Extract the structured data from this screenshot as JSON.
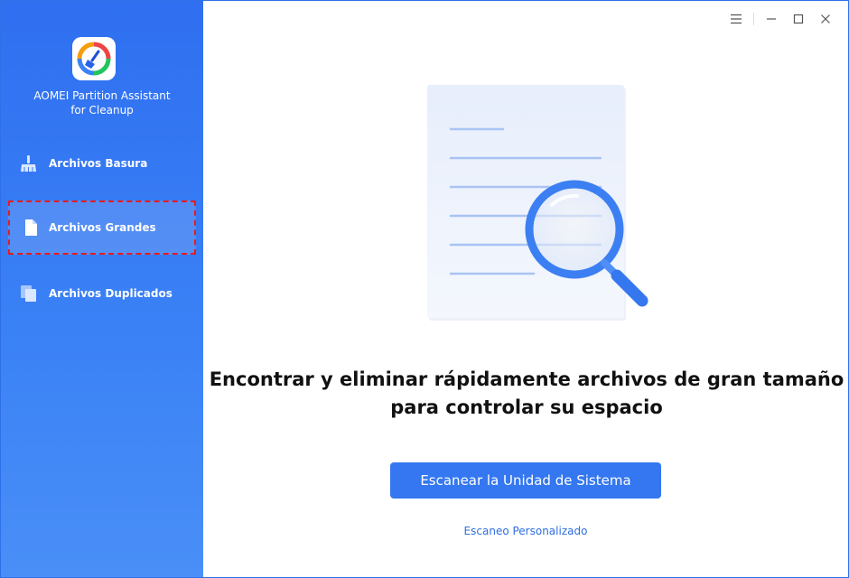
{
  "app": {
    "title_line1": "AOMEI Partition Assistant",
    "title_line2": "for Cleanup",
    "logo_icon": "broom-icon"
  },
  "sidebar": {
    "items": [
      {
        "label": "Archivos Basura",
        "icon": "broom-icon",
        "active": false
      },
      {
        "label": "Archivos Grandes",
        "icon": "file-icon",
        "active": true
      },
      {
        "label": "Archivos Duplicados",
        "icon": "copy-icon",
        "active": false
      }
    ]
  },
  "window_controls": [
    "menu-icon",
    "minimize-icon",
    "maximize-icon",
    "close-icon"
  ],
  "main": {
    "headline_line1": "Encontrar y eliminar rápidamente archivos de gran tamaño",
    "headline_line2": "para controlar su espacio",
    "primary_button": "Escanear la Unidad de Sistema",
    "secondary_link": "Escaneo Personalizado"
  },
  "colors": {
    "sidebar": "#2f6ff0",
    "accent": "#3477f0",
    "active_border": "#e81b1b",
    "link": "#2f6fe0"
  }
}
